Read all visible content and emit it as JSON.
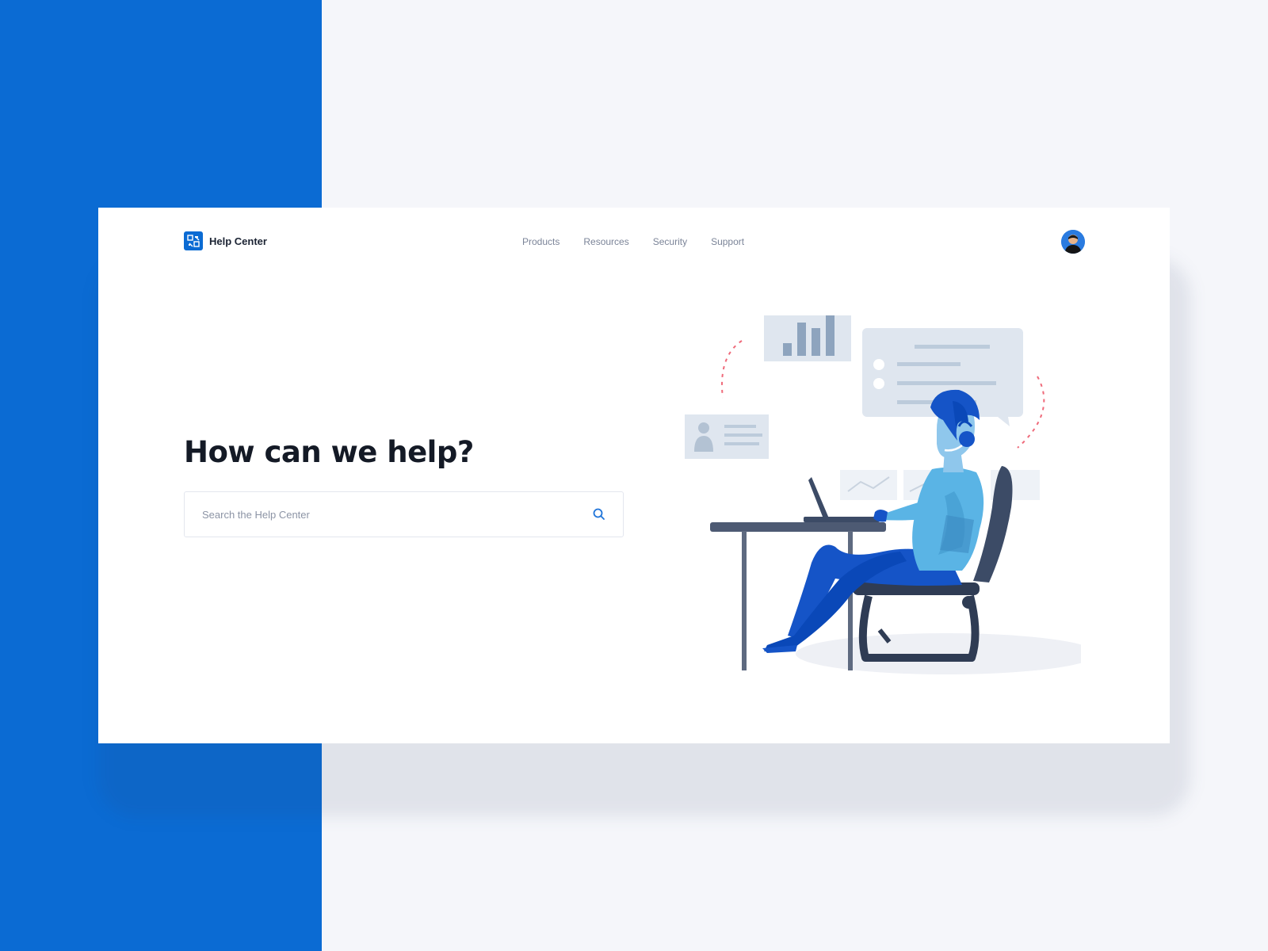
{
  "app": {
    "brand_name": "Help Center",
    "brand_icon": "help-center-logo-icon"
  },
  "nav": {
    "items": [
      {
        "label": "Products"
      },
      {
        "label": "Resources"
      },
      {
        "label": "Security"
      },
      {
        "label": "Support"
      }
    ]
  },
  "hero": {
    "title": "How can we help?"
  },
  "search": {
    "placeholder": "Search the Help Center",
    "value": "",
    "icon": "search-icon"
  },
  "colors": {
    "brand": "#0b6bd3",
    "background": "#f5f6fa",
    "card": "#ffffff",
    "title": "#141a26",
    "nav_text": "#7b8498"
  }
}
